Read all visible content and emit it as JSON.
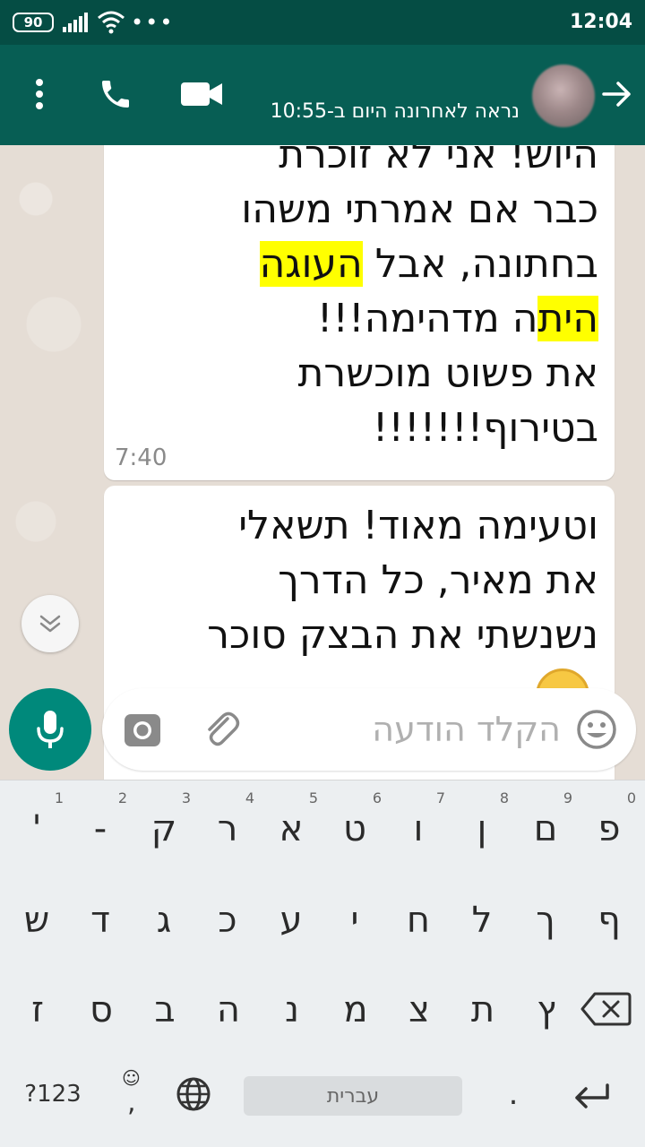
{
  "status_bar": {
    "battery": "90",
    "time": "12:04"
  },
  "header": {
    "last_seen": "נראה לאחרונה היום ב-10:55"
  },
  "messages": [
    {
      "lines": [
        [
          {
            "t": "היוש! אני לא זוכרת"
          }
        ],
        [
          {
            "t": "כבר אם אמרתי משהו"
          }
        ],
        [
          {
            "t": "בחתונה, אבל "
          },
          {
            "t": "העוגה",
            "hl": true
          }
        ],
        [
          {
            "t": "הית",
            "hl": true
          },
          {
            "t": "ה מדהימה!!!"
          }
        ],
        [
          {
            "t": "את פשוט מוכשרת"
          }
        ],
        [
          {
            "t": "בטירוף!!!!!!!"
          }
        ]
      ],
      "time": "7:40"
    },
    {
      "lines": [
        [
          {
            "t": "וטעימה מאוד! תשאלי"
          }
        ],
        [
          {
            "t": "את מאיר, כל הדרך"
          }
        ],
        [
          {
            "t": "נשנשתי את הבצק סוכר"
          }
        ]
      ]
    }
  ],
  "input": {
    "placeholder": "הקלד הודעה",
    "value": ""
  },
  "keyboard": {
    "row1": [
      {
        "k": "פ",
        "h": "0"
      },
      {
        "k": "ם",
        "h": "9"
      },
      {
        "k": "ן",
        "h": "8"
      },
      {
        "k": "ו",
        "h": "7"
      },
      {
        "k": "ט",
        "h": "6"
      },
      {
        "k": "א",
        "h": "5"
      },
      {
        "k": "ר",
        "h": "4"
      },
      {
        "k": "ק",
        "h": "3"
      },
      {
        "k": "-",
        "h": "2"
      },
      {
        "k": "'",
        "h": "1"
      }
    ],
    "row2": [
      {
        "k": "ף"
      },
      {
        "k": "ך"
      },
      {
        "k": "ל"
      },
      {
        "k": "ח"
      },
      {
        "k": "י"
      },
      {
        "k": "ע"
      },
      {
        "k": "כ"
      },
      {
        "k": "ג"
      },
      {
        "k": "ד"
      },
      {
        "k": "ש"
      }
    ],
    "row3": [
      {
        "k": "ץ"
      },
      {
        "k": "ת"
      },
      {
        "k": "צ"
      },
      {
        "k": "מ"
      },
      {
        "k": "נ"
      },
      {
        "k": "ה"
      },
      {
        "k": "ב"
      },
      {
        "k": "ס"
      },
      {
        "k": "ז"
      }
    ],
    "symbols_label": "?123",
    "comma": ",",
    "space_label": "עברית",
    "period": "."
  },
  "colors": {
    "status_bar": "#054d44",
    "header": "#075e54",
    "chat_background": "#e5ddd5",
    "accent": "#00897b",
    "highlight": "#ffff00",
    "keyboard": "#eceff1"
  }
}
